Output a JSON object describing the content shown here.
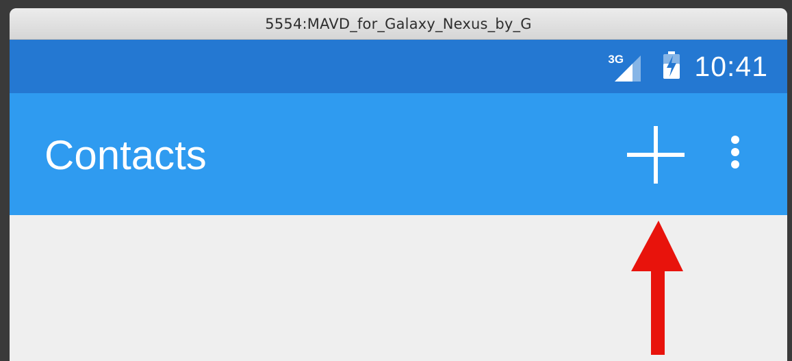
{
  "window": {
    "title": "5554:MAVD_for_Galaxy_Nexus_by_G"
  },
  "status_bar": {
    "network_type": "3G",
    "time": "10:41",
    "background_color": "#2478d2",
    "icons": [
      "signal-icon",
      "battery-charging-icon"
    ]
  },
  "app_bar": {
    "title": "Contacts",
    "background_color": "#2f9bf0",
    "actions": [
      {
        "name": "add-contact-button",
        "icon": "plus-icon"
      },
      {
        "name": "overflow-menu-button",
        "icon": "more-vertical-icon"
      }
    ]
  },
  "annotation": {
    "type": "arrow-up",
    "color": "#e8130c",
    "points_to": "add-contact-button"
  }
}
